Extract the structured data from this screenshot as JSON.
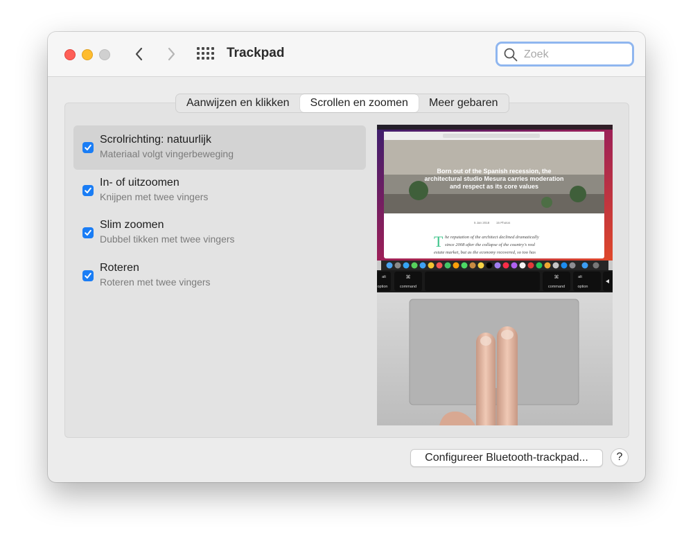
{
  "window": {
    "title": "Trackpad",
    "search": {
      "placeholder": "Zoek",
      "value": ""
    }
  },
  "tabs": [
    {
      "label": "Aanwijzen en klikken",
      "selected": false
    },
    {
      "label": "Scrollen en zoomen",
      "selected": true
    },
    {
      "label": "Meer gebaren",
      "selected": false
    }
  ],
  "options": [
    {
      "title": "Scrolrichting: natuurlijk",
      "subtitle": "Materiaal volgt vingerbeweging",
      "checked": true,
      "selected": true
    },
    {
      "title": "In- of uitzoomen",
      "subtitle": "Knijpen met twee vingers",
      "checked": true,
      "selected": false
    },
    {
      "title": "Slim zoomen",
      "subtitle": "Dubbel tikken met twee vingers",
      "checked": true,
      "selected": false
    },
    {
      "title": "Roteren",
      "subtitle": "Roteren met twee vingers",
      "checked": true,
      "selected": false
    }
  ],
  "preview": {
    "headline_lines": [
      "Born out of the Spanish recession, the",
      "architectural studio Mesura carries moderation",
      "and respect as its core values"
    ],
    "meta_date": "5 Jan 2018",
    "meta_photos": "15 Photos",
    "dropcap": "T",
    "body_lines": [
      "he reputation of the architect declined dramatically",
      "since 2008 after the collapse of the country's real",
      "estate market, but as the economy recovered, so too has"
    ],
    "keys": {
      "alt": "alt",
      "option": "option",
      "cmd_symbol": "⌘",
      "command": "command"
    }
  },
  "footer": {
    "configure_button": "Configureer Bluetooth-trackpad...",
    "help_label": "?"
  },
  "colors": {
    "accent": "#1a7df5",
    "close": "#fe5f57",
    "minimize": "#febc2e",
    "zoom": "#d0d0d0",
    "search_focus": "#8fb6ef"
  }
}
